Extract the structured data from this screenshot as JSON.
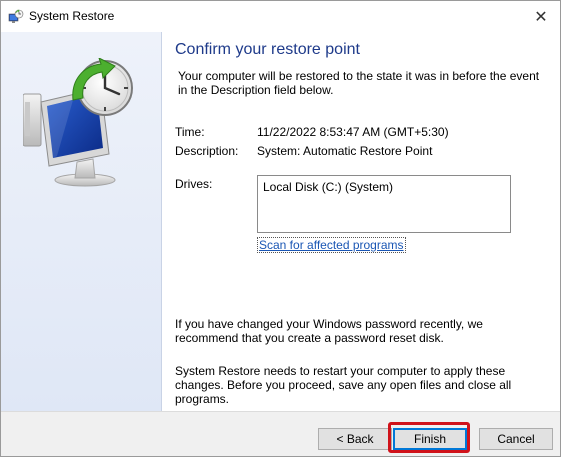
{
  "window": {
    "title": "System Restore",
    "close_glyph": "✕"
  },
  "heading": "Confirm your restore point",
  "intro": "Your computer will be restored to the state it was in before the event in the Description field below.",
  "details": {
    "time_label": "Time:",
    "time_value": "11/22/2022 8:53:47 AM (GMT+5:30)",
    "description_label": "Description:",
    "description_value": "System: Automatic Restore Point",
    "drives_label": "Drives:",
    "drives": [
      "Local Disk (C:) (System)"
    ]
  },
  "scan_link": "Scan for affected programs",
  "note_password": "If you have changed your Windows password recently, we recommend that you create a password reset disk.",
  "note_restart": "System Restore needs to restart your computer to apply these changes. Before you proceed, save any open files and close all programs.",
  "buttons": {
    "back": "< Back",
    "finish": "Finish",
    "cancel": "Cancel"
  },
  "icons": {
    "app": "system-restore-icon",
    "hero": "restore-monitor-clock-icon",
    "close": "close-icon"
  },
  "colors": {
    "heading": "#1e3a8a",
    "link": "#1a56b4",
    "highlight": "#d0121a"
  }
}
